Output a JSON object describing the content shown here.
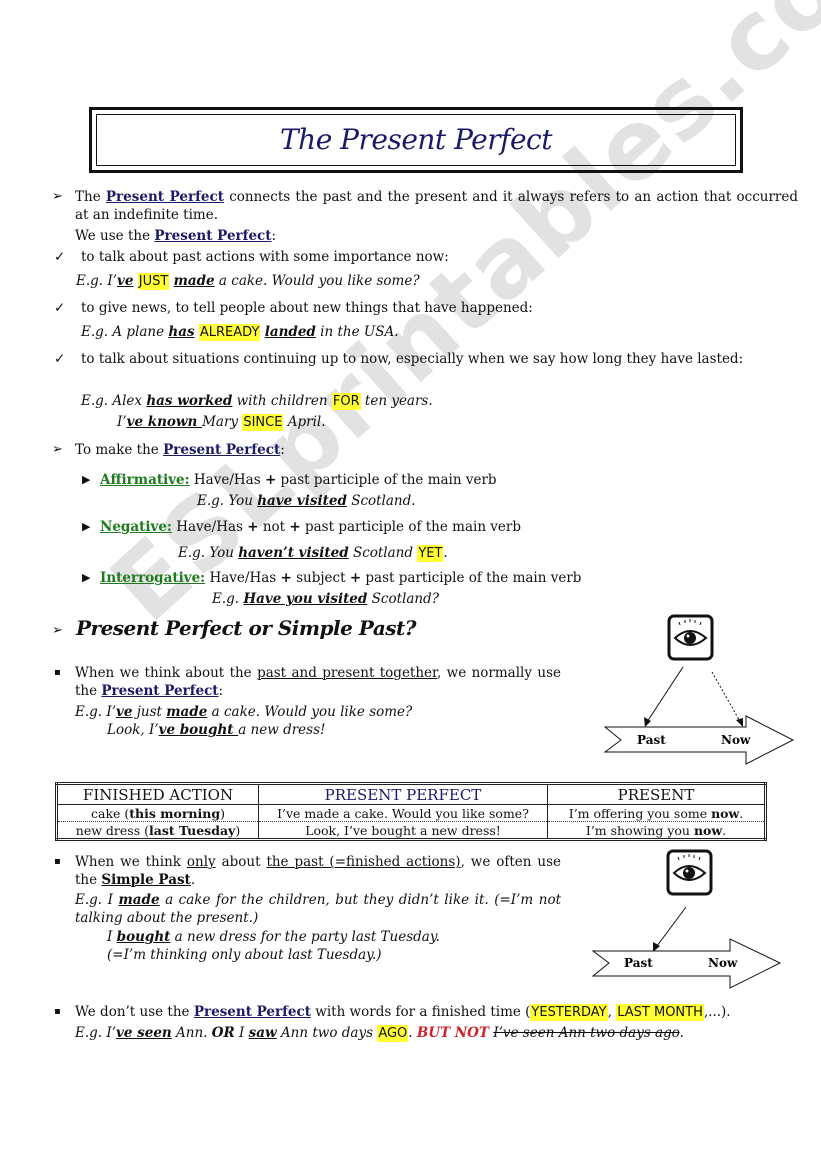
{
  "title": "The Present Perfect",
  "intro": {
    "line1_pre": "The ",
    "term": "Present Perfect",
    "line1_post": " connects the past and the present and it always refers to an action that occurred at an indefinite time.",
    "use_pre": "We use the ",
    "use_post": ":"
  },
  "uses": [
    {
      "text": "to talk about past actions with some importance now:",
      "example": {
        "eg": "E.g. I’",
        "v1": "ve",
        "hl": "JUST",
        "v2": "made",
        "rest": " a cake. Would you like some?"
      }
    },
    {
      "text": "to give news, to tell people about new things that have happened:",
      "example": {
        "eg": "E.g. A plane ",
        "v1": "has",
        "hl": "ALREADY",
        "v2": "landed",
        "rest": " in the USA."
      }
    },
    {
      "text": "to talk about situations continuing up to now, especially when we say how long they have lasted:",
      "example": {
        "eg": "E.g. Alex ",
        "v1": "has worked",
        "mid": " with children ",
        "hl": "FOR",
        "rest": " ten years."
      },
      "example2": {
        "pre": "I’",
        "v1": "ve known ",
        "mid": "Mary ",
        "hl": "SINCE",
        "rest": " April."
      }
    }
  ],
  "make": {
    "pre": "To make the ",
    "term": "Present Perfect",
    "post": ":",
    "forms": [
      {
        "label": "Affirmative:",
        "rule_parts": [
          "Have/Has ",
          "+",
          " past participle of the main verb"
        ],
        "example": {
          "eg": "E.g. You ",
          "verb": "have visited",
          "rest": " Scotland."
        }
      },
      {
        "label": "Negative:",
        "rule_parts": [
          "Have/Has ",
          "+",
          " not ",
          "+",
          " past participle of the main verb"
        ],
        "example": {
          "eg": "E.g. You ",
          "verb": "haven’t visited",
          "rest": " Scotland ",
          "hl": "YET",
          "end": "."
        }
      },
      {
        "label": "Interrogative:",
        "rule_parts": [
          "Have/Has ",
          "+",
          " subject ",
          "+",
          " past participle of the main verb"
        ],
        "example": {
          "eg": "E.g. ",
          "verb": "Have you visited",
          "rest": " Scotland?"
        }
      }
    ]
  },
  "comparison": {
    "heading": "Present Perfect or Simple Past?",
    "pp_point": {
      "w1": "When we think about the ",
      "u": "past and present together",
      "w2": ", we normally use the ",
      "term": "Present Perfect",
      "end": ":",
      "ex1": {
        "eg": "E.g. I’",
        "v1": "ve",
        "mid": " just ",
        "v2": "made",
        "rest": " a cake. Would you like some?"
      },
      "ex2": {
        "pre": "Look, I’",
        "v": "ve bought ",
        "rest": "a new dress!"
      }
    },
    "diagram1": {
      "past": "Past",
      "now": "Now"
    },
    "table": {
      "headers": [
        "FINISHED ACTION",
        "PRESENT PERFECT",
        "PRESENT"
      ],
      "rows": [
        {
          "c1_pre": "cake (",
          "c1_bold": "this morning",
          "c1_post": ")",
          "c2": "I’ve made a cake. Would you like some?",
          "c3_pre": "I’m offering you some ",
          "c3_bold": "now",
          "c3_post": "."
        },
        {
          "c1_pre": "new dress (",
          "c1_bold": "last Tuesday",
          "c1_post": ")",
          "c2": "Look, I’ve bought a new dress!",
          "c3_pre": "I’m showing you ",
          "c3_bold": "now",
          "c3_post": "."
        }
      ]
    },
    "sp_point": {
      "w1": "When we think ",
      "u1": "only",
      "w2": " about ",
      "u2": "the past (=finished actions)",
      "w3": ", we often use the ",
      "term": "Simple Past",
      "end": ".",
      "ex1": {
        "eg": "E.g. I ",
        "v": "made",
        "rest": " a cake for the children, but they didn’t like it.   (=I’m not talking about the present.)"
      },
      "ex2": {
        "pre": "I ",
        "v": "bought",
        "rest": " a new dress for the party last Tuesday."
      },
      "ex3": "(=I’m thinking only about last Tuesday.)"
    },
    "diagram2": {
      "past": "Past",
      "now": "Now"
    },
    "finished_time": {
      "w1": "We don’t use the ",
      "term": "Present Perfect",
      "w2": " with words for a finished time (",
      "hl1": "YESTERDAY",
      "sep": ", ",
      "hl2": "LAST MONTH",
      "w3": ",...).",
      "ex_eg": "E.g. I’",
      "ex_v1": "ve seen",
      "ex_mid1": " Ann. ",
      "ex_or": "OR",
      "ex_mid2": " I ",
      "ex_v2": "saw",
      "ex_mid3": " Ann two days ",
      "ex_hl": "AGO",
      "ex_dot": ". ",
      "ex_butnot": "BUT NOT",
      "ex_struck": "I’ve seen Ann two days ago",
      "ex_end": "."
    }
  },
  "watermark": "ESLprintables.com",
  "colors": {
    "term": "#1a1a66",
    "form_label": "#1d7a1d",
    "highlight": "#ffff33",
    "warning": "#d0202a"
  }
}
